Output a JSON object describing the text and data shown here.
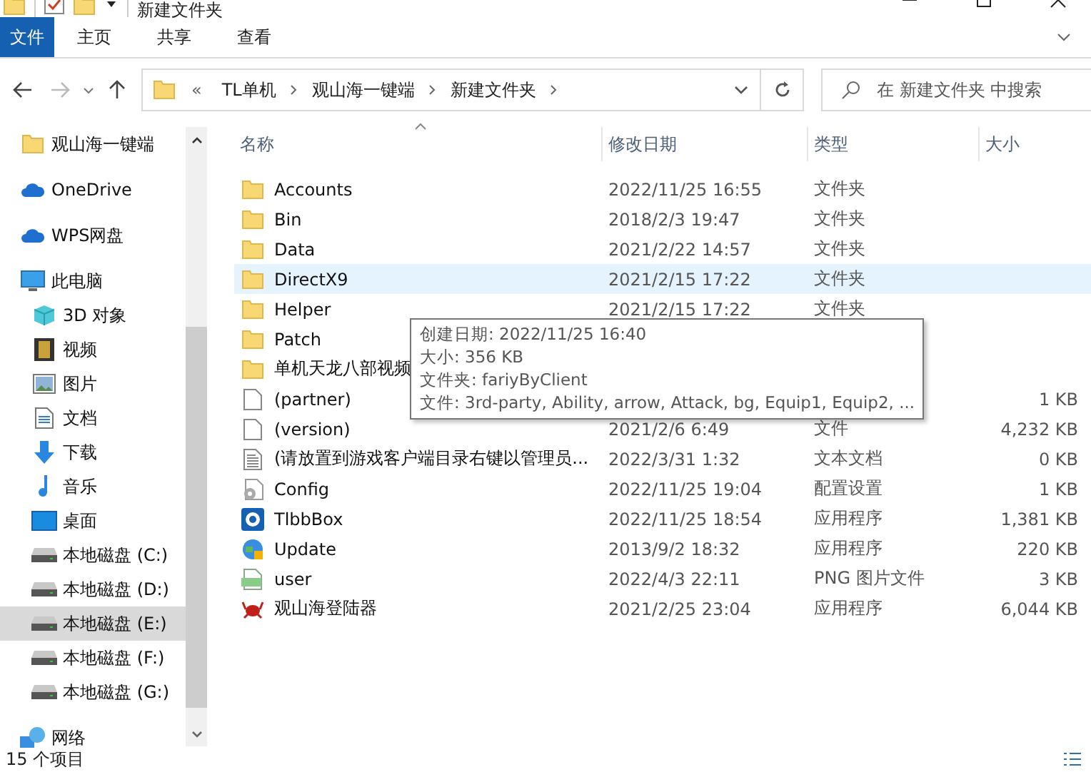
{
  "window": {
    "title": "新建文件夹"
  },
  "ribbon": {
    "tabs": [
      {
        "label": "文件",
        "selected": true
      },
      {
        "label": "主页",
        "selected": false
      },
      {
        "label": "共享",
        "selected": false
      },
      {
        "label": "查看",
        "selected": false
      }
    ]
  },
  "address": {
    "overflow": "«",
    "path": [
      "TL单机",
      "观山海一键端",
      "新建文件夹"
    ]
  },
  "search": {
    "placeholder": "在 新建文件夹 中搜索"
  },
  "sidebar": {
    "items": [
      {
        "label": "观山海一键端",
        "kind": "folder",
        "selected": false
      },
      {
        "label": "OneDrive",
        "kind": "cloud",
        "selected": false
      },
      {
        "label": "WPS网盘",
        "kind": "cloud",
        "selected": false
      },
      {
        "label": "此电脑",
        "kind": "computer",
        "selected": false,
        "children": [
          {
            "label": "3D 对象",
            "kind": "cube",
            "selected": false
          },
          {
            "label": "视频",
            "kind": "film",
            "selected": false
          },
          {
            "label": "图片",
            "kind": "picture",
            "selected": false
          },
          {
            "label": "文档",
            "kind": "document",
            "selected": false
          },
          {
            "label": "下载",
            "kind": "download",
            "selected": false
          },
          {
            "label": "音乐",
            "kind": "music",
            "selected": false
          },
          {
            "label": "桌面",
            "kind": "desktop",
            "selected": false
          },
          {
            "label": "本地磁盘 (C:)",
            "kind": "drive",
            "selected": false
          },
          {
            "label": "本地磁盘 (D:)",
            "kind": "drive",
            "selected": false
          },
          {
            "label": "本地磁盘 (E:)",
            "kind": "drive",
            "selected": true
          },
          {
            "label": "本地磁盘 (F:)",
            "kind": "drive",
            "selected": false
          },
          {
            "label": "本地磁盘 (G:)",
            "kind": "drive",
            "selected": false
          }
        ]
      },
      {
        "label": "网络",
        "kind": "network",
        "selected": false
      }
    ]
  },
  "table": {
    "columns": [
      "名称",
      "修改日期",
      "类型",
      "大小"
    ],
    "rows": [
      {
        "name": "Accounts",
        "modified": "2022/11/25 16:55",
        "type": "文件夹",
        "kind": "folder",
        "hovered": false
      },
      {
        "name": "Bin",
        "modified": "2018/2/3 19:47",
        "type": "文件夹",
        "kind": "folder",
        "hovered": false
      },
      {
        "name": "Data",
        "modified": "2021/2/22 14:57",
        "type": "文件夹",
        "kind": "folder",
        "hovered": false
      },
      {
        "name": "DirectX9",
        "modified": "2021/2/15 17:22",
        "type": "文件夹",
        "kind": "folder",
        "hovered": true
      },
      {
        "name": "Helper",
        "modified": "2021/2/15 17:22",
        "type": "文件夹",
        "kind": "folder",
        "hovered": false
      },
      {
        "name": "Patch",
        "kind": "folder",
        "hovered": false
      },
      {
        "name": "单机天龙八部视频",
        "kind": "folder",
        "hovered": false
      },
      {
        "name": "(partner)",
        "size": "1 KB",
        "kind": "file",
        "hovered": false
      },
      {
        "name": "(version)",
        "modified": "2021/2/6 6:49",
        "type": "文件",
        "size": "4,232 KB",
        "kind": "file",
        "hovered": false
      },
      {
        "name": "(请放置到游戏客户端目录右键以管理员...",
        "modified": "2022/3/31 1:32",
        "type": "文本文档",
        "size": "0 KB",
        "kind": "text",
        "hovered": false
      },
      {
        "name": "Config",
        "modified": "2022/11/25 19:04",
        "type": "配置设置",
        "size": "1 KB",
        "kind": "config",
        "hovered": false
      },
      {
        "name": "TlbbBox",
        "modified": "2022/11/25 18:54",
        "type": "应用程序",
        "size": "1,381 KB",
        "kind": "app",
        "hovered": false
      },
      {
        "name": "Update",
        "modified": "2013/9/2 18:32",
        "type": "应用程序",
        "size": "220 KB",
        "kind": "globe",
        "hovered": false
      },
      {
        "name": "user",
        "modified": "2022/4/3 22:11",
        "type": "PNG 图片文件",
        "size": "3 KB",
        "kind": "png",
        "hovered": false
      },
      {
        "name": "观山海登陆器",
        "modified": "2021/2/25 23:04",
        "type": "应用程序",
        "size": "6,044 KB",
        "kind": "crab",
        "hovered": false
      }
    ]
  },
  "tooltip": {
    "lines": [
      "创建日期: 2022/11/25 16:40",
      "大小: 356 KB",
      "文件夹: fariyByClient",
      "文件: 3rd-party, Ability, arrow, Attack, bg, Equip1, Equip2, ..."
    ]
  },
  "status_bar": {
    "count": "15 个项目"
  }
}
